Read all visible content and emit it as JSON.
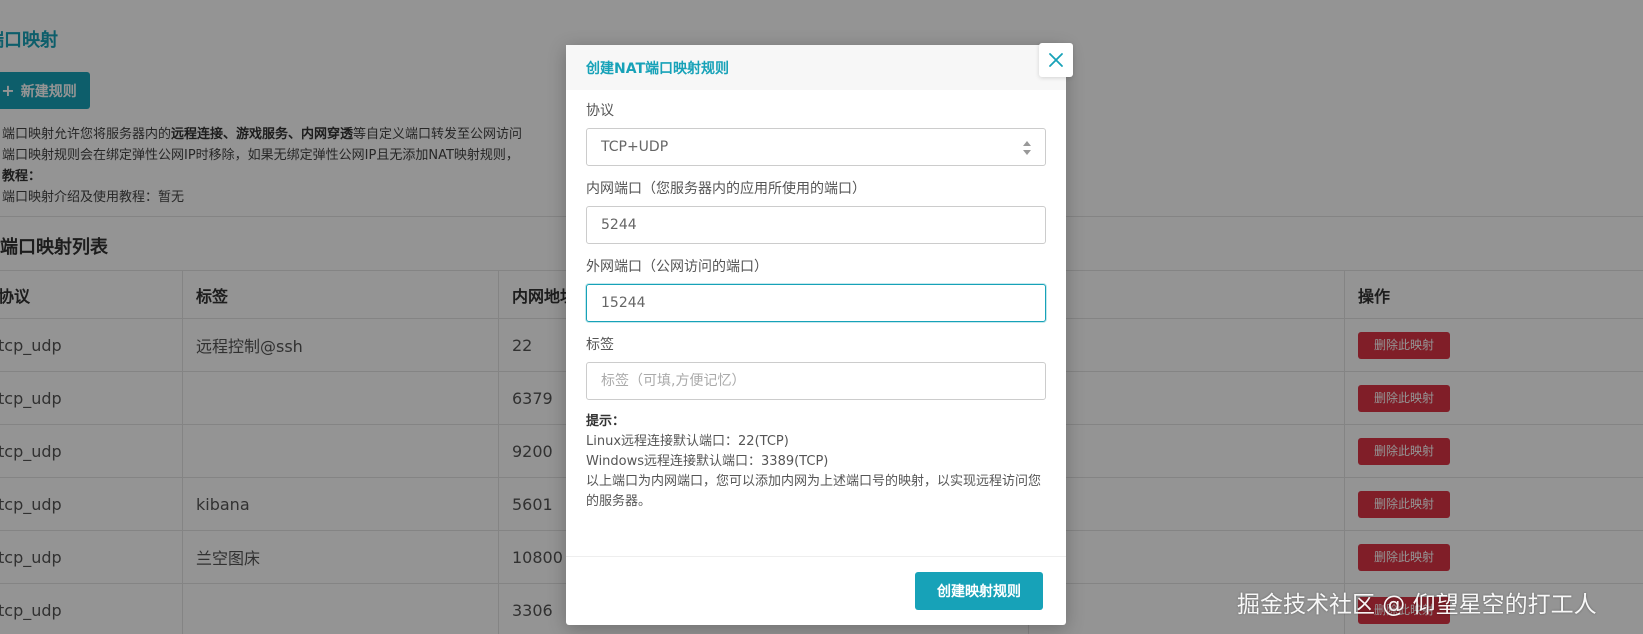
{
  "page": {
    "title": "端口映射",
    "new_rule_label": "新建规则",
    "notes": {
      "line1_prefix": "端口映射允许您将服务器内的",
      "line1_bold": "远程连接、游戏服务、内网穿透",
      "line1_suffix": "等自定义端口转发至公网访问",
      "line2": "端口映射规则会在绑定弹性公网IP时移除，如果无绑定弹性公网IP且无添加NAT映射规则，",
      "tutorial_label": "教程：",
      "tutorial_text": "端口映射介绍及使用教程：暂无"
    },
    "list_title": "端口映射列表",
    "table": {
      "headers": [
        "协议",
        "标签",
        "内网地址",
        "",
        "操作"
      ],
      "rows": [
        {
          "protocol": "tcp_udp",
          "label": "远程控制@ssh",
          "internal": "22",
          "action": "删除此映射"
        },
        {
          "protocol": "tcp_udp",
          "label": "",
          "internal": "6379",
          "action": "删除此映射"
        },
        {
          "protocol": "tcp_udp",
          "label": "",
          "internal": "9200",
          "action": "删除此映射"
        },
        {
          "protocol": "tcp_udp",
          "label": "kibana",
          "internal": "5601",
          "action": "删除此映射"
        },
        {
          "protocol": "tcp_udp",
          "label": "兰空图床",
          "internal": "10800",
          "action": "删除此映射"
        },
        {
          "protocol": "tcp_udp",
          "label": "",
          "internal": "3306",
          "action": "删除此映射"
        }
      ]
    }
  },
  "modal": {
    "title": "创建NAT端口映射规则",
    "close_icon": "close-icon",
    "protocol": {
      "label": "协议",
      "value": "TCP+UDP"
    },
    "internal_port": {
      "label": "内网端口（您服务器内的应用所使用的端口）",
      "value": "5244"
    },
    "external_port": {
      "label": "外网端口（公网访问的端口）",
      "value": "15244"
    },
    "tag": {
      "label": "标签",
      "placeholder": "标签（可填,方便记忆）",
      "value": ""
    },
    "tips": {
      "title": "提示：",
      "line1": "Linux远程连接默认端口：22(TCP)",
      "line2": "Windows远程连接默认端口：3389(TCP)",
      "line3": "以上端口为内网端口，您可以添加内网为上述端口号的映射，以实现远程访问您的服务器。"
    },
    "submit_label": "创建映射规则"
  },
  "watermark": "掘金技术社区 @ 仰望星空的打工人",
  "colors": {
    "accent": "#17a2b8",
    "danger": "#dc3545",
    "overlay": "rgba(0,0,0,0.42)"
  }
}
